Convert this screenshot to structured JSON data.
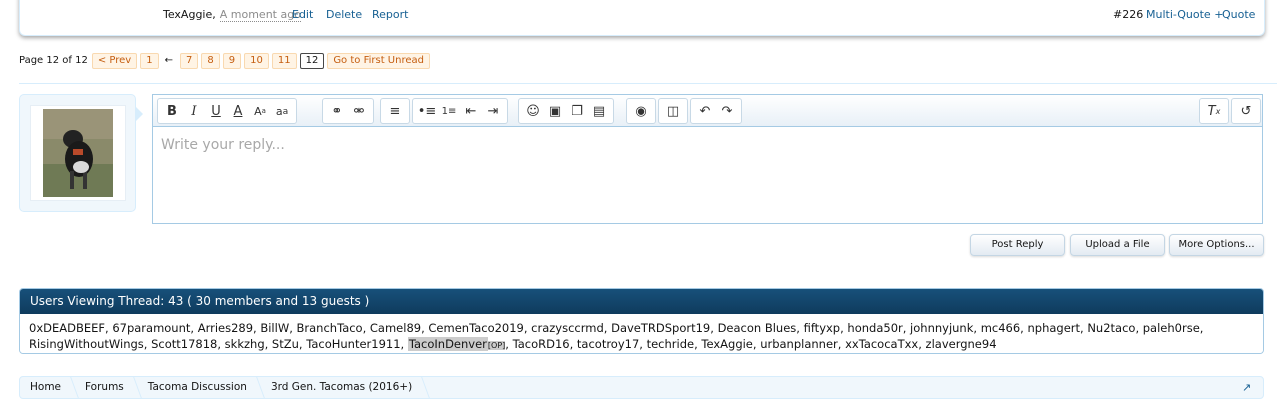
{
  "post_footer": {
    "author": "TexAggie,",
    "date": "A moment ago",
    "edit": "Edit",
    "delete": "Delete",
    "report": "Report",
    "post_number": "#226",
    "multi_quote": "Multi-Quote +",
    "quote": "Quote"
  },
  "pagenav": {
    "label": "Page 12 of 12",
    "prev": "< Prev",
    "pages": [
      "1",
      "7",
      "8",
      "9",
      "10",
      "11",
      "12"
    ],
    "skip": "←",
    "first_unread": "Go to First Unread"
  },
  "editor": {
    "placeholder": "Write your reply...",
    "toolbar_icons": [
      "bold-icon",
      "italic-icon",
      "underline-icon",
      "font-color-icon",
      "font-size-icon",
      "font-family-icon",
      "link-icon",
      "unlink-icon",
      "align-icon",
      "bullet-list-icon",
      "number-list-icon",
      "outdent-icon",
      "indent-icon",
      "smilie-icon",
      "image-icon",
      "media-icon",
      "quote-icon",
      "camera-icon",
      "save-icon",
      "undo-icon",
      "redo-icon",
      "remove-format-icon",
      "toggle-bbcode-icon"
    ]
  },
  "buttons": {
    "post_reply": "Post Reply",
    "upload": "Upload a File",
    "more_options": "More Options..."
  },
  "users_viewing": {
    "title": "Users Viewing Thread: 43 ( 30 members and 13 guests )",
    "line1": "0xDEADBEEF, 67paramount, Arries289, BillW, BranchTaco, Camel89, CemenTaco2019, crazysccrmd, DaveTRDSport19, Deacon Blues, fiftyxp, honda50r, johnnyjunk, mc466, nphagert, Nu2taco, paleh0rse,",
    "line2_before": "RisingWithoutWings, Scott17818, skkzhg, StZu, TacoHunter1911, ",
    "highlight_user": "TacoInDenver",
    "op_tag": "[OP]",
    "line2_after": ", TacoRD16, tacotroy17, techride, TexAggie, urbanplanner, xxTacocaTxx, zlavergne94"
  },
  "breadcrumb": {
    "items": [
      "Home",
      "Forums",
      "Tacoma Discussion",
      "3rd Gen. Tacomas (2016+)"
    ]
  },
  "colors": {
    "link": "#176093",
    "header_bg": "#0f3b5d",
    "page_button_bg": "#fff4e5",
    "page_button_text": "#c55e11"
  }
}
